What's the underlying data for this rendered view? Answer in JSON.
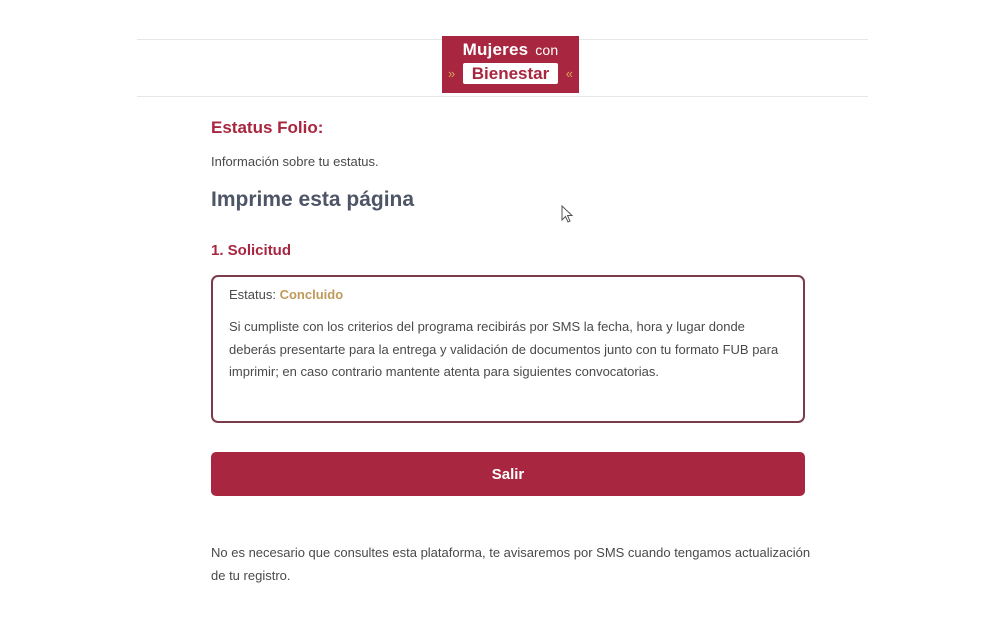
{
  "logo": {
    "line1_main": "Mujeres",
    "line1_small": "con",
    "line2": "Bienestar",
    "leaf_icon_left": "»",
    "leaf_icon_right": "«"
  },
  "status_page": {
    "title": "Estatus Folio:",
    "info": "Información sobre tu estatus.",
    "print_heading": "Imprime esta página",
    "step": "1. Solicitud",
    "status_label": "Estatus:",
    "status_value": "Concluido",
    "message": "Si cumpliste con los criterios del programa recibirás por SMS la fecha, hora y lugar donde deberás presentarte para la entrega y validación de documentos junto con tu formato FUB para imprimir; en caso contrario mantente atenta para siguientes convocatorias.",
    "exit_label": "Salir",
    "footer": "No es necesario que consultes esta plataforma, te avisaremos por SMS cuando tengamos actualización de tu registro."
  },
  "colors": {
    "brand": "#a8263f",
    "status_accent": "#c09a5b",
    "heading_gray": "#4d5566"
  }
}
